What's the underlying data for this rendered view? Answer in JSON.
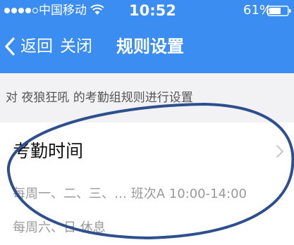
{
  "status_bar": {
    "carrier": "中国移动",
    "time": "10:52",
    "battery": "61%"
  },
  "nav": {
    "back": "返回",
    "close": "关闭",
    "title": "规则设置"
  },
  "hint": "对 夜狼狂吼 的考勤组规则进行设置",
  "attendance": {
    "title": "考勤时间",
    "schedule": [
      "每周一、二、三、…  班次A  10:00-14:00",
      "每周六、日  休息"
    ]
  },
  "colors": {
    "header_blue": "#3b8df1",
    "annotation_ellipse": "#2d4f8e"
  }
}
